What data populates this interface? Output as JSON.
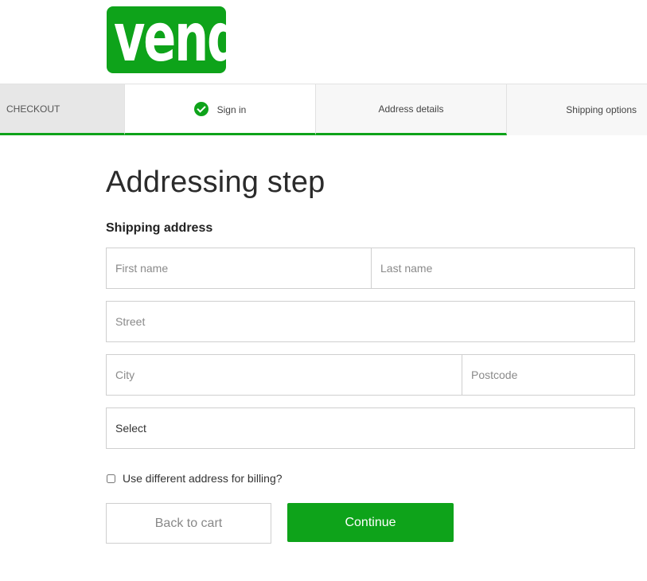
{
  "brand": {
    "logo_text": "vend",
    "color": "#0ea31a"
  },
  "steps": [
    {
      "label": "CHECKOUT"
    },
    {
      "label": "Sign in",
      "icon": "check-circle-icon",
      "completed": true
    },
    {
      "label": "Address details"
    },
    {
      "label": "Shipping options"
    }
  ],
  "page": {
    "title": "Addressing step",
    "section_title": "Shipping address"
  },
  "form": {
    "first_name": {
      "placeholder": "First name",
      "value": ""
    },
    "last_name": {
      "placeholder": "Last name",
      "value": ""
    },
    "street": {
      "placeholder": "Street",
      "value": ""
    },
    "city": {
      "placeholder": "City",
      "value": ""
    },
    "postcode": {
      "placeholder": "Postcode",
      "value": ""
    },
    "country_select": {
      "selected": "Select"
    },
    "billing_checkbox": {
      "label": "Use different address for billing?",
      "checked": false
    }
  },
  "actions": {
    "back_label": "Back to cart",
    "continue_label": "Continue"
  }
}
